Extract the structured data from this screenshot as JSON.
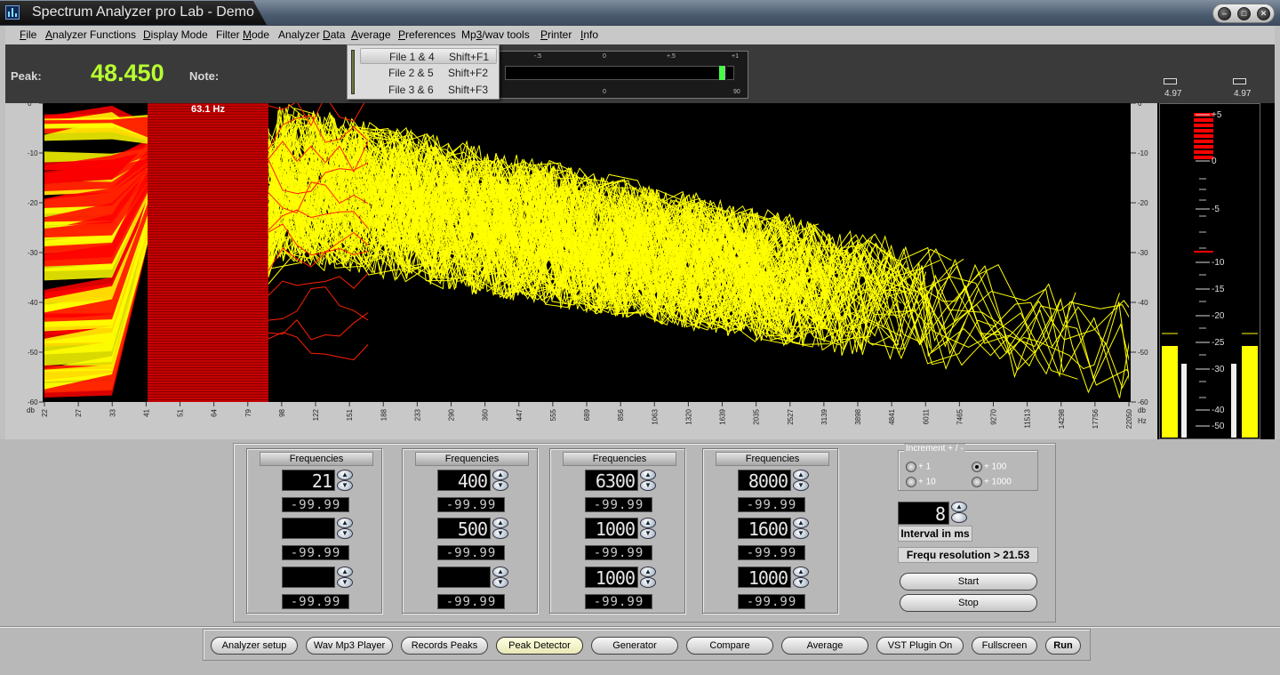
{
  "window": {
    "title": "Spectrum Analyzer pro Lab - Demo"
  },
  "menu": [
    "File",
    "Analyzer Functions",
    "Display Mode",
    "Filter Mode",
    "Analyzer Data",
    "Average",
    "Preferences",
    "Mp3/wav tools",
    "Printer",
    "Info"
  ],
  "menu_accel": [
    "F",
    "A",
    "D",
    "M",
    "D",
    "A",
    "P",
    "3",
    "P",
    "I"
  ],
  "dropdown": [
    {
      "label": "File 1 & 4",
      "shortcut": "Shift+F1"
    },
    {
      "label": "File 2 & 5",
      "shortcut": "Shift+F2"
    },
    {
      "label": "File 3 & 6",
      "shortcut": "Shift+F3"
    }
  ],
  "top": {
    "peak_label": "Peak:",
    "peak_value": "48.450",
    "note_label": "Note:",
    "tuner_top_ticks": [
      "-.5",
      "0",
      "+.5",
      "+1"
    ],
    "tuner_bottom_ticks": [
      "0",
      "90"
    ],
    "vu_left_value": "4.97",
    "vu_right_value": "4.97"
  },
  "spectrum": {
    "peak_freq_label": "63.1 Hz",
    "y_ticks": [
      "0",
      "-10",
      "-20",
      "-30",
      "-40",
      "-50",
      "-60"
    ],
    "y_unit": "db",
    "x_unit": "Hz",
    "x_ticks": [
      "22",
      "27",
      "33",
      "41",
      "51",
      "64",
      "79",
      "98",
      "122",
      "151",
      "188",
      "233",
      "290",
      "360",
      "447",
      "555",
      "689",
      "856",
      "1063",
      "1320",
      "1639",
      "2035",
      "2527",
      "3139",
      "3898",
      "4841",
      "6011",
      "7465",
      "9270",
      "11513",
      "14298",
      "17756",
      "22050"
    ],
    "colors": {
      "peak": "#ff0000",
      "trace": "#ffff00",
      "background": "#000000"
    }
  },
  "vu": {
    "scale": [
      "+5",
      "0",
      "-5",
      "-10",
      "-15",
      "-20",
      "-25",
      "-30",
      "-40",
      "-50"
    ]
  },
  "frequencies": [
    {
      "title": "Frequencies",
      "rows": [
        {
          "freq": "21",
          "level": "-99.99"
        },
        {
          "freq": "",
          "level": "-99.99"
        },
        {
          "freq": "",
          "level": "-99.99"
        }
      ]
    },
    {
      "title": "Frequencies",
      "rows": [
        {
          "freq": "400",
          "level": "-99.99"
        },
        {
          "freq": "500",
          "level": "-99.99"
        },
        {
          "freq": "",
          "level": "-99.99"
        }
      ]
    },
    {
      "title": "Frequencies",
      "rows": [
        {
          "freq": "6300",
          "level": "-99.99"
        },
        {
          "freq": "1000",
          "level": "-99.99"
        },
        {
          "freq": "1000",
          "level": "-99.99"
        }
      ]
    },
    {
      "title": "Frequencies",
      "rows": [
        {
          "freq": "8000",
          "level": "-99.99"
        },
        {
          "freq": "1600",
          "level": "-99.99"
        },
        {
          "freq": "1000",
          "level": "-99.99"
        }
      ]
    }
  ],
  "increment": {
    "title": "Increment + / -",
    "options": [
      {
        "label": "+ 1",
        "selected": false
      },
      {
        "label": "+ 100",
        "selected": true
      },
      {
        "label": "+ 10",
        "selected": false
      },
      {
        "label": "+ 1000",
        "selected": false
      }
    ]
  },
  "interval": {
    "value": "8",
    "label": "Interval in ms"
  },
  "freq_resolution": "Frequ resolution > 21.53",
  "controls": {
    "start": "Start",
    "stop": "Stop"
  },
  "toolbar": [
    "Analyzer setup",
    "Wav Mp3 Player",
    "Records Peaks",
    "Peak Detector",
    "Generator",
    "Compare",
    "Average",
    "VST Plugin On",
    "Fullscreen",
    "Run"
  ],
  "toolbar_selected": "Peak Detector"
}
